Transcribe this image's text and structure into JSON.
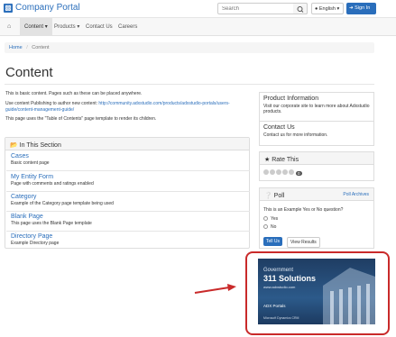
{
  "header": {
    "brand": "Company Portal",
    "search_placeholder": "Search",
    "language": "English",
    "signin": "Sign In"
  },
  "nav": {
    "home_icon": "home-icon",
    "items": [
      "Content",
      "Products",
      "Contact Us",
      "Careers"
    ]
  },
  "breadcrumb": {
    "home": "Home",
    "current": "Content"
  },
  "main": {
    "title": "Content",
    "para1": "This is basic content. Pages such as these can be placed anywhere.",
    "para2_prefix": "Use content Publishing to author new content:",
    "para2_link": "http://community.adxstudio.com/products/adxstudio-portals/users-guide/content-management-guide/",
    "para3": "This page uses the \"Table of Contents\" page template to render its children."
  },
  "section": {
    "header": "In This Section",
    "items": [
      {
        "title": "Cases",
        "desc": "Basic content page"
      },
      {
        "title": "My Entity Form",
        "desc": "Page with comments and ratings enabled"
      },
      {
        "title": "Category",
        "desc": "Example of the Category page template being used"
      },
      {
        "title": "Blank Page",
        "desc": "This page uses the Blank Page template"
      },
      {
        "title": "Directory Page",
        "desc": "Example Directory page"
      }
    ]
  },
  "sidebar": {
    "product_title": "Product Information",
    "product_text": "Visit our corporate site to learn more about Adxstudio products.",
    "contact_title": "Contact Us",
    "contact_text": "Contact us for more information.",
    "rate_title": "Rate This",
    "rate_count": "0",
    "poll_title": "Poll",
    "poll_archives": "Poll Archives",
    "poll_question": "This is an Example Yes or No question?",
    "poll_yes": "Yes",
    "poll_no": "No",
    "poll_submit": "Tell Us",
    "poll_results": "View Results"
  },
  "ad": {
    "line1": "Government",
    "line2": "311 Solutions",
    "line3": "www.adxstudio.com",
    "line4": "ADX Portals",
    "line5": "Microsoft Dynamics CRM"
  },
  "colors": {
    "accent": "#2a6ebb",
    "highlight": "#c92a2a"
  }
}
